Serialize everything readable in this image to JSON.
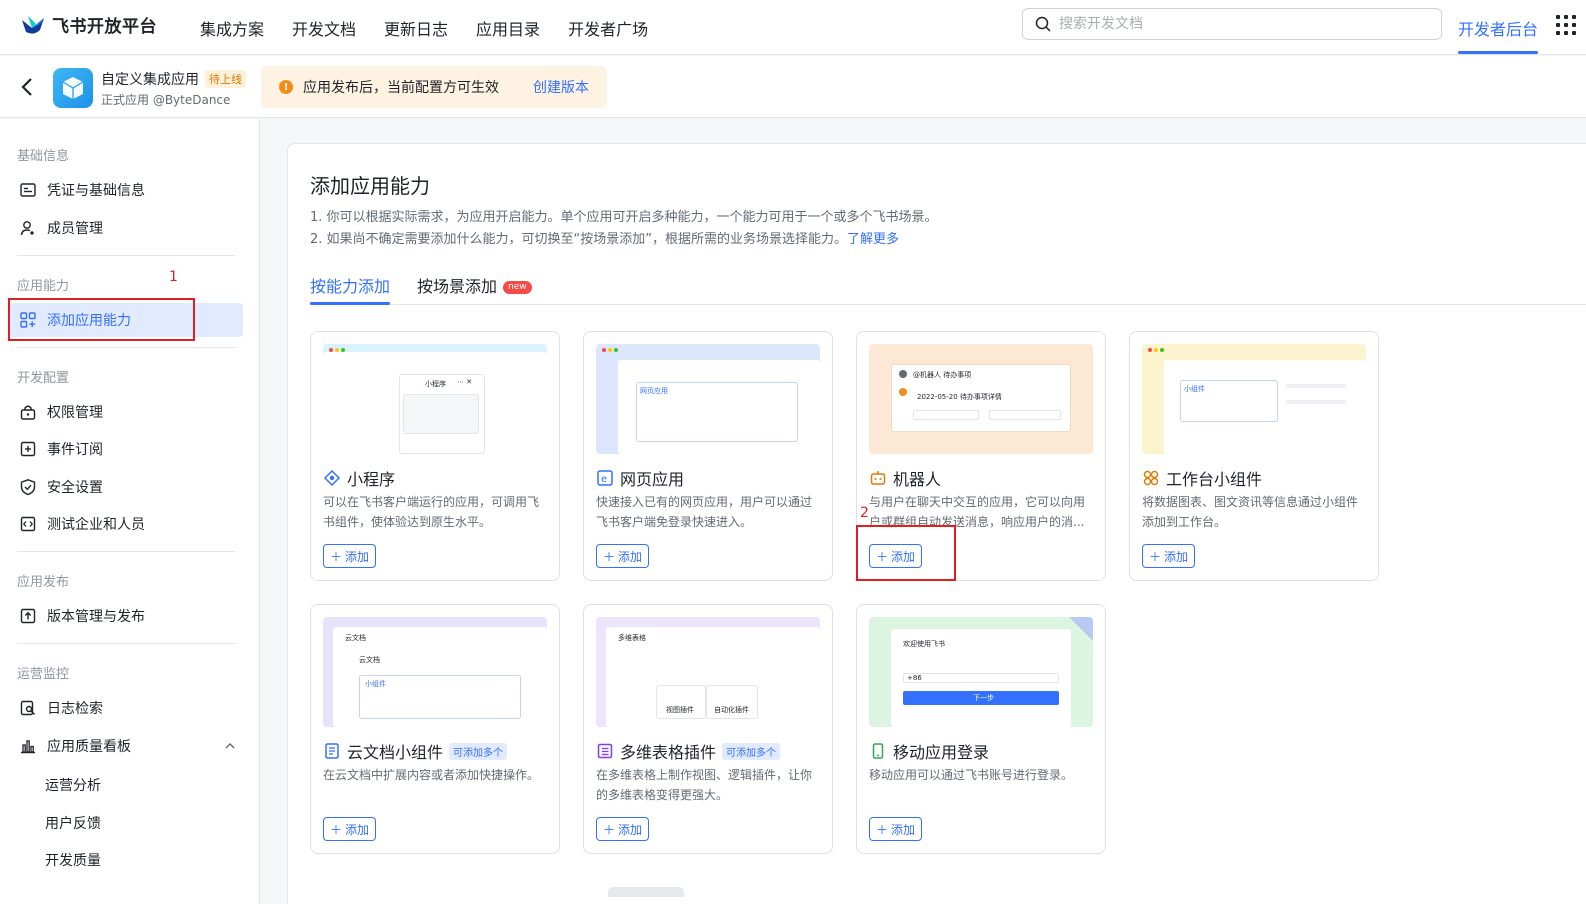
{
  "header": {
    "logo_text": "飞书开放平台",
    "nav": [
      "集成方案",
      "开发文档",
      "更新日志",
      "应用目录",
      "开发者广场"
    ],
    "search_placeholder": "搜索开发文档",
    "dev_console": "开发者后台"
  },
  "app": {
    "name": "自定义集成应用",
    "status_badge": "待上线",
    "subtitle": "正式应用 @ByteDance",
    "notice_text": "应用发布后，当前配置方可生效",
    "notice_link": "创建版本"
  },
  "sidebar": {
    "groups": [
      {
        "label": "基础信息",
        "items": [
          "凭证与基础信息",
          "成员管理"
        ]
      },
      {
        "label": "应用能力",
        "items": [
          "添加应用能力"
        ]
      },
      {
        "label": "开发配置",
        "items": [
          "权限管理",
          "事件订阅",
          "安全设置",
          "测试企业和人员"
        ]
      },
      {
        "label": "应用发布",
        "items": [
          "版本管理与发布"
        ]
      },
      {
        "label": "运营监控",
        "items": [
          "日志检索",
          "应用质量看板"
        ],
        "subitems": [
          "运营分析",
          "用户反馈",
          "开发质量"
        ]
      }
    ],
    "active_item": "添加应用能力"
  },
  "annotations": {
    "box1_label": "1",
    "box2_label": "2"
  },
  "main": {
    "title": "添加应用能力",
    "desc1": "1. 你可以根据实际需求，为应用开启能力。单个应用可开启多种能力，一个能力可用于一个或多个飞书场景。",
    "desc2": "2. 如果尚不确定需要添加什么能力，可切换至“按场景添加”，根据所需的业务场景选择能力。",
    "desc2_link": "了解更多",
    "tabs": [
      "按能力添加",
      "按场景添加"
    ],
    "new_badge": "new",
    "active_tab": "按能力添加",
    "add_label": "添加",
    "multi_badge": "可添加多个",
    "cards": [
      {
        "title": "小程序",
        "desc": "可以在飞书客户端运行的应用，可调用飞书组件，使体验达到原生水平。",
        "icon": "mini-program-icon",
        "preview_text": "小程序"
      },
      {
        "title": "网页应用",
        "desc": "快速接入已有的网页应用，用户可以通过飞书客户端免登录快速进入。",
        "icon": "web-app-icon",
        "preview_text": "网页应用"
      },
      {
        "title": "机器人",
        "desc": "与用户在聊天中交互的应用，它可以向用户或群组自动发送消息，响应用户的消...",
        "icon": "robot-icon",
        "preview_text": "@机器人 待办事项",
        "preview_date": "2022-05-20 待办事项详情"
      },
      {
        "title": "工作台小组件",
        "desc": "将数据图表、图文资讯等信息通过小组件添加到工作台。",
        "icon": "widget-icon",
        "preview_text": "小组件"
      },
      {
        "title": "云文档小组件",
        "desc": "在云文档中扩展内容或者添加快捷操作。",
        "icon": "doc-widget-icon",
        "multi": true,
        "preview_text": "云文档",
        "preview_sub": "小组件"
      },
      {
        "title": "多维表格插件",
        "desc": "在多维表格上制作视图、逻辑插件，让你的多维表格变得更强大。",
        "icon": "bitable-plugin-icon",
        "multi": true,
        "preview_text": "多维表格",
        "preview_a": "视图插件",
        "preview_b": "自动化插件"
      },
      {
        "title": "移动应用登录",
        "desc": "移动应用可以通过飞书账号进行登录。",
        "icon": "mobile-login-icon",
        "preview_text": "欢迎使用飞书",
        "preview_next": "下一步",
        "preview_code": "+86"
      }
    ]
  },
  "colors": {
    "brand": "#3370ff",
    "annotation": "#e02020",
    "warning": "#f48d17"
  }
}
